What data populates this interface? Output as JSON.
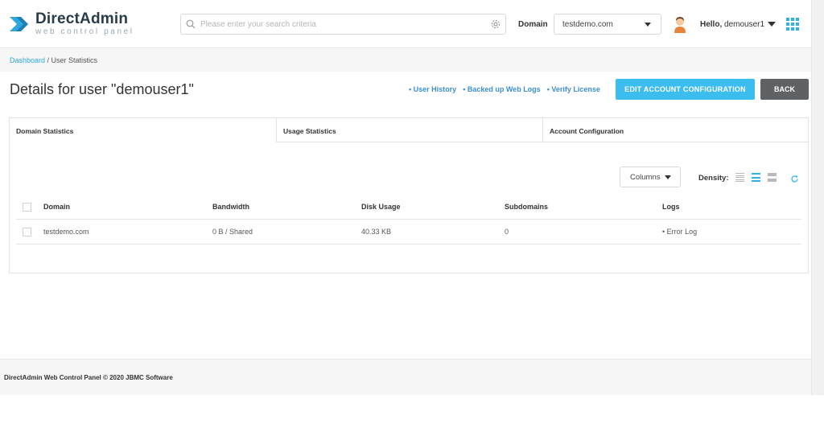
{
  "app": {
    "logo_title": "DirectAdmin",
    "logo_subtitle": "web control panel"
  },
  "header": {
    "search_placeholder": "Please enter your search criteria",
    "domain_label": "Domain",
    "domain_value": "testdemo.com",
    "hello_label": "Hello,",
    "username": "demouser1"
  },
  "breadcrumb": {
    "home": "Dashboard",
    "separator": " / ",
    "current": "User Statistics"
  },
  "page": {
    "title": "Details for user \"demouser1\"",
    "links": [
      "• User History",
      "• Backed up Web Logs",
      "• Verify License"
    ],
    "edit_button": "EDIT ACCOUNT CONFIGURATION",
    "back_button": "BACK"
  },
  "tabs": [
    "Domain Statistics",
    "Usage Statistics",
    "Account Configuration"
  ],
  "toolbar": {
    "columns_label": "Columns",
    "density_label": "Density:"
  },
  "table": {
    "headers": [
      "Domain",
      "Bandwidth",
      "Disk Usage",
      "Subdomains",
      "Logs"
    ],
    "rows": [
      {
        "domain": "testdemo.com",
        "bandwidth": "0 B / Shared",
        "disk": "40.33 KB",
        "subdomains": "0",
        "logs": "• Error Log"
      }
    ]
  },
  "footer": {
    "text": "DirectAdmin Web Control Panel © 2020 JBMC Software"
  },
  "colors": {
    "accent": "#3cbdf0",
    "link": "#3a8fd6",
    "back_button": "#5f6264"
  }
}
